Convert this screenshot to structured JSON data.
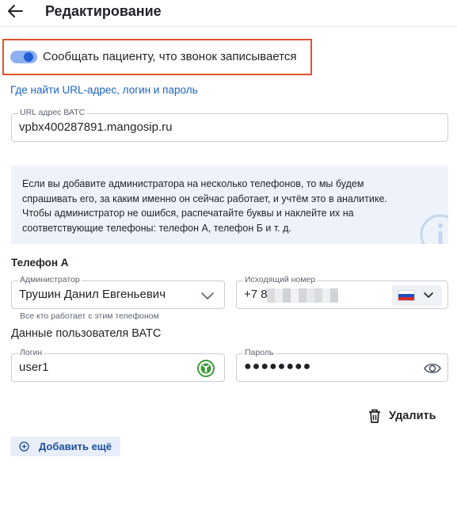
{
  "header": {
    "title": "Редактирование",
    "back_icon": "arrow-left-icon"
  },
  "recording_toggle": {
    "label": "Сообщать пациенту, что звонок записывается",
    "enabled": true,
    "accent": "#1e5fd6"
  },
  "help_link": {
    "text": "Где найти URL-адрес, логин и пароль",
    "color": "#1d63c6"
  },
  "vats_url": {
    "label": "URL адрес ВАТС",
    "value": "vpbx400287891.mangosip.ru"
  },
  "info": {
    "lines": [
      "Если вы добавите администратора на несколько телефонов, то мы будем",
      "спрашивать его, за каким именно он сейчас работает, и учтём это в аналитике.",
      "Чтобы администратор не ошибся, распечатайте буквы и наклейте их на",
      "соответствующие телефоны: телефон А, телефон Б и т. д."
    ],
    "icon": "info-icon"
  },
  "phone_section": {
    "title": "Телефон А",
    "administrator": {
      "label": "Администратор",
      "value": "Трушин Данил Евгеньевич",
      "helper": "Все кто работает с этим телефоном"
    },
    "outgoing_number": {
      "label": "Исходящий номер",
      "prefix": "+7 8",
      "country_flag": "russia-flag-icon"
    },
    "credentials_title": "Данные пользователя ВАТС",
    "login": {
      "label": "Логин",
      "value": "user1",
      "icon": "password-manager-icon"
    },
    "password": {
      "label": "Пароль",
      "masked_value": "●●●●●●●●",
      "icon": "eye-icon"
    }
  },
  "actions": {
    "delete_label": "Удалить",
    "add_more_label": "Добавить ещё"
  },
  "colors": {
    "highlight_border": "#e0532d",
    "info_background": "#eef3fb"
  }
}
